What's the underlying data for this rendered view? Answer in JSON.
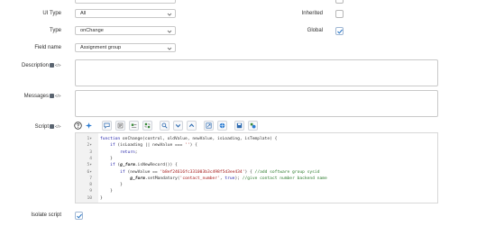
{
  "form": {
    "ui_type": {
      "label": "UI Type",
      "value": "All"
    },
    "type": {
      "label": "Type",
      "value": "onChange"
    },
    "field_name": {
      "label": "Field name",
      "value": "Assignment group"
    },
    "inherited": {
      "label": "Inherited",
      "checked": false
    },
    "global": {
      "label": "Global",
      "checked": true
    },
    "description": {
      "label": "Description",
      "value": ""
    },
    "messages": {
      "label": "Messages",
      "value": ""
    },
    "script": {
      "label": "Script"
    },
    "isolate_script": {
      "label": "Isolate script",
      "checked": true
    }
  },
  "format_marker": "</>",
  "toolbar": {
    "icons": [
      "help-icon",
      "script-assist-icon",
      "comment-icon",
      "format-icon",
      "toggle-syntax-icon",
      "replace-icon",
      "search-icon",
      "find-next-icon",
      "find-prev-icon",
      "fullscreen-icon",
      "script-debugger-icon",
      "save-icon",
      "scripting-palette-icon"
    ]
  },
  "code_lines": [
    {
      "n": "1",
      "fold": true,
      "text": "function onChange(control, oldValue, newValue, isLoading, isTemplate) {"
    },
    {
      "n": "2",
      "fold": true,
      "text": "    if (isLoading || newValue === '') {"
    },
    {
      "n": "3",
      "fold": false,
      "text": "        return;"
    },
    {
      "n": "4",
      "fold": false,
      "text": "    }"
    },
    {
      "n": "5",
      "fold": true,
      "text": "    if (g_form.isNewRecord()) {"
    },
    {
      "n": "6",
      "fold": true,
      "text": "        if (newValue == 'b8ef24616fc331003b3c498f5d3ee434') { //add software group sysid"
    },
    {
      "n": "7",
      "fold": false,
      "text": "            g_form.setMandatory('contact_number', true); //give contact number backend name"
    },
    {
      "n": "8",
      "fold": false,
      "text": "        }"
    },
    {
      "n": "9",
      "fold": false,
      "text": "    }"
    },
    {
      "n": "10",
      "fold": false,
      "text": "}"
    }
  ],
  "colors": {
    "accent": "#1f6fc2",
    "border": "#c9c9c9",
    "gutter": "#f2f2f2"
  }
}
